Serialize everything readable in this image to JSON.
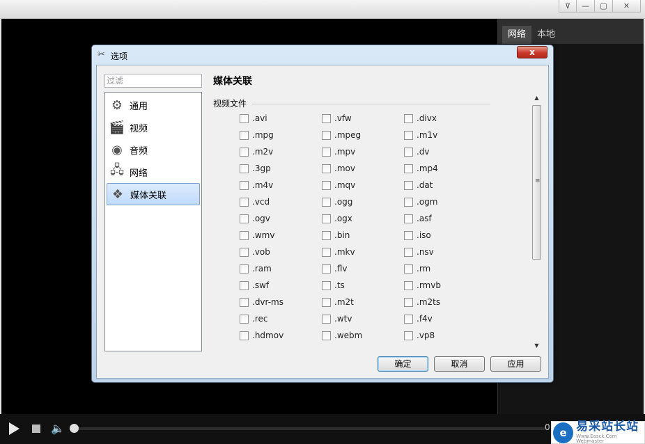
{
  "player": {
    "right_tabs": [
      "网络",
      "本地"
    ],
    "time_text": "0"
  },
  "window_controls": {
    "menu_icon": "dropdown-icon",
    "minimize_icon": "minimize-icon",
    "maximize_icon": "maximize-icon",
    "close_icon": "close-icon"
  },
  "dialog": {
    "title": "选项",
    "close_label": "x",
    "filter_placeholder": "过滤",
    "nav": [
      {
        "label": "通用",
        "icon": "gear-icon"
      },
      {
        "label": "视频",
        "icon": "clapperboard-icon"
      },
      {
        "label": "音频",
        "icon": "speaker-icon"
      },
      {
        "label": "网络",
        "icon": "network-icon"
      },
      {
        "label": "媒体关联",
        "icon": "media-association-icon",
        "selected": true
      }
    ],
    "section_title": "媒体关联",
    "group_label": "视频文件",
    "extensions": [
      [
        ".avi",
        ".vfw",
        ".divx"
      ],
      [
        ".mpg",
        ".mpeg",
        ".m1v"
      ],
      [
        ".m2v",
        ".mpv",
        ".dv"
      ],
      [
        ".3gp",
        ".mov",
        ".mp4"
      ],
      [
        ".m4v",
        ".mqv",
        ".dat"
      ],
      [
        ".vcd",
        ".ogg",
        ".ogm"
      ],
      [
        ".ogv",
        ".ogx",
        ".asf"
      ],
      [
        ".wmv",
        ".bin",
        ".iso"
      ],
      [
        ".vob",
        ".mkv",
        ".nsv"
      ],
      [
        ".ram",
        ".flv",
        ".rm"
      ],
      [
        ".swf",
        ".ts",
        ".rmvb"
      ],
      [
        ".dvr-ms",
        ".m2t",
        ".m2ts"
      ],
      [
        ".rec",
        ".wtv",
        ".f4v"
      ],
      [
        ".hdmov",
        ".webm",
        ".vp8"
      ]
    ],
    "buttons": {
      "ok": "确定",
      "cancel": "取消",
      "apply": "应用"
    }
  },
  "watermark": {
    "logo": "e",
    "title": "易采站长站",
    "subtitle": "Www.Easck.Com  Webmaster"
  },
  "colors": {
    "accent_selection": "#c1dbfc",
    "dialog_frame": "#bcd3ea",
    "close_red": "#c8382a"
  }
}
